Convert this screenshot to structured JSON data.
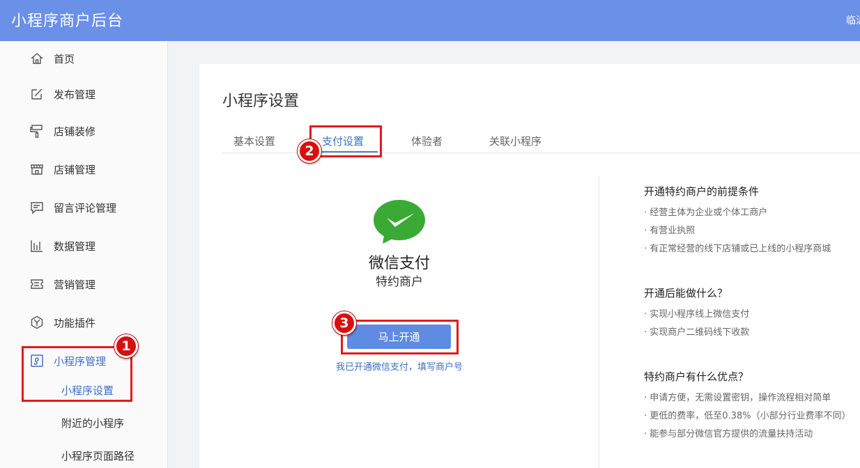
{
  "header": {
    "title": "小程序商户后台",
    "user_text": "临沂"
  },
  "sidebar": {
    "items": [
      {
        "label": "首页",
        "icon": "home-icon"
      },
      {
        "label": "发布管理",
        "icon": "edit-icon"
      },
      {
        "label": "店铺装修",
        "icon": "paint-roller-icon"
      },
      {
        "label": "店铺管理",
        "icon": "store-icon"
      },
      {
        "label": "留言评论管理",
        "icon": "comment-icon"
      },
      {
        "label": "数据管理",
        "icon": "bar-chart-icon"
      },
      {
        "label": "营销管理",
        "icon": "ticket-icon"
      },
      {
        "label": "功能插件",
        "icon": "plugin-icon"
      },
      {
        "label": "小程序管理",
        "icon": "mini-program-icon"
      }
    ],
    "sub_items": [
      {
        "label": "小程序设置"
      },
      {
        "label": "附近的小程序"
      },
      {
        "label": "小程序页面路径"
      }
    ]
  },
  "main": {
    "title": "小程序设置",
    "tabs": [
      {
        "label": "基本设置"
      },
      {
        "label": "支付设置"
      },
      {
        "label": "体验者"
      },
      {
        "label": "关联小程序"
      }
    ],
    "wechat_pay": {
      "title": "微信支付",
      "subtitle": "特约商户",
      "button": "马上开通",
      "link": "我已开通微信支付，填写商户号"
    },
    "info_sections": [
      {
        "heading": "开通特约商户的前提条件",
        "lines": [
          "· 经营主体为企业或个体工商户",
          "· 有营业执照",
          "· 有正常经营的线下店铺或已上线的小程序商城"
        ]
      },
      {
        "heading": "开通后能做什么？",
        "lines": [
          "· 实现小程序线上微信支付",
          "· 实现商户二维码线下收款"
        ]
      },
      {
        "heading": "特约商户有什么优点？",
        "lines": [
          "· 申请方便，无需设置密钥，操作流程相对简单",
          "· 更低的费率，低至0.38%（小部分行业费率不同）",
          "· 能参与部分微信官方提供的流量扶持活动"
        ]
      }
    ]
  },
  "annotations": [
    "1",
    "2",
    "3"
  ],
  "colors": {
    "header": "#6a90e8",
    "accent": "#3d6fc7",
    "button": "#5f8be3",
    "wechat_green": "#3aaa35",
    "annotation_red": "#e21b1b"
  }
}
